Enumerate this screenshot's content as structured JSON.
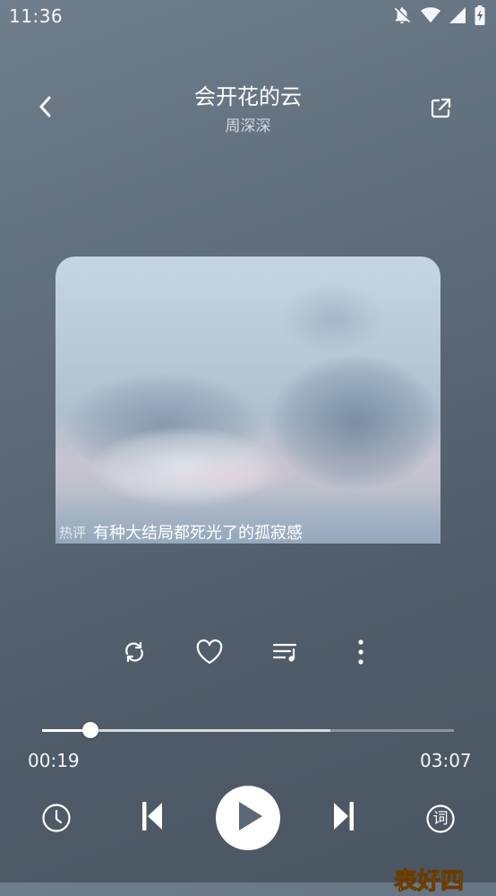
{
  "status_bar": {
    "time": "11:36",
    "icons": [
      "notifications-off-icon",
      "wifi-icon",
      "cell-signal-icon",
      "battery-icon"
    ]
  },
  "header": {
    "back_icon": "chevron-left-icon",
    "song_title": "会开花的云",
    "artist": "周深深",
    "share_icon": "share-external-icon"
  },
  "cover": {
    "hot_comment_tag": "热评",
    "hot_comment": "有种大结局都死光了的孤寂感"
  },
  "actions": [
    {
      "name": "repeat-icon"
    },
    {
      "name": "heart-icon"
    },
    {
      "name": "playlist-icon"
    },
    {
      "name": "more-vert-icon"
    }
  ],
  "player": {
    "current_time": "00:19",
    "total_time": "03:07",
    "progress_fraction": 0.118,
    "buffer_fraction": 0.7
  },
  "controls": {
    "timer_icon": "clock-icon",
    "prev_icon": "skip-previous-icon",
    "play_icon": "play-icon",
    "next_icon": "skip-next-icon",
    "lyrics_icon": "lyrics-icon",
    "lyrics_glyph": "词"
  },
  "overlay_banner": "表好四"
}
